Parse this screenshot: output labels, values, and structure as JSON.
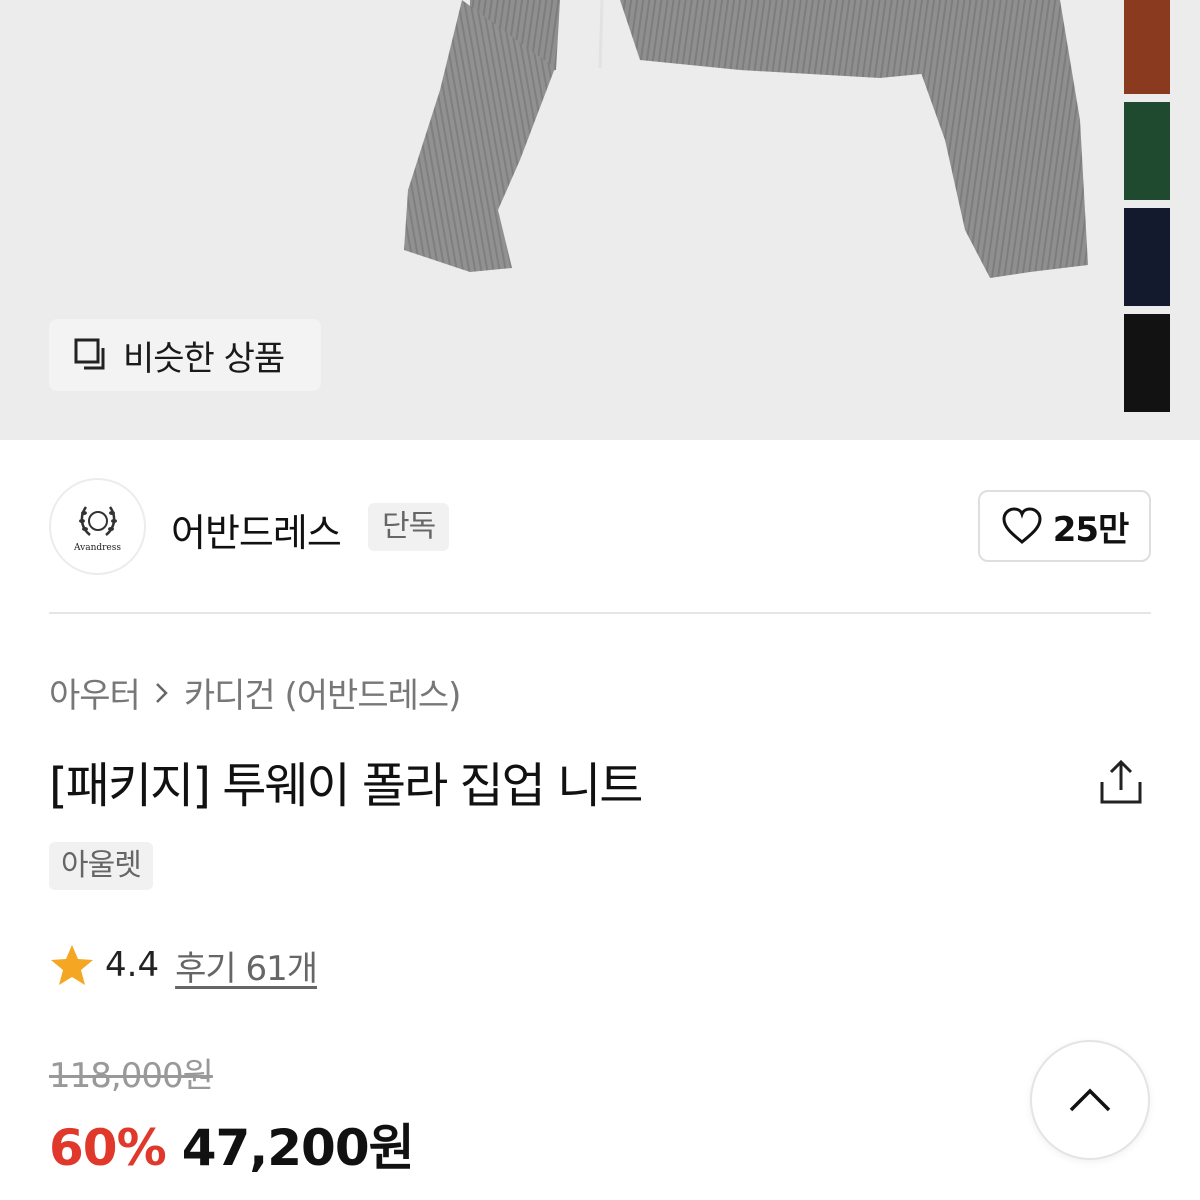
{
  "colors": {
    "accent_discount": "#e0392b",
    "star": "#f5a623",
    "hero_bg": "#ececec",
    "knit_gray": "#8d8d8d",
    "swatches": [
      "#8a3a1e",
      "#1f4a30",
      "#141a2e",
      "#121212"
    ]
  },
  "hero": {
    "similar_button": {
      "icon": "copy-icon",
      "label": "비슷한 상품"
    }
  },
  "brand": {
    "logo_text": "Avandress",
    "name": "어반드레스",
    "badge": "단독",
    "like": {
      "icon": "heart-icon",
      "count": "25만"
    }
  },
  "breadcrumb": {
    "level1": "아우터",
    "separator_icon": "chevron-right-icon",
    "level2": "카디건 (어반드레스)"
  },
  "product": {
    "title": "[패키지] 투웨이 폴라 집업 니트",
    "share_icon": "share-icon",
    "tag": "아울렛",
    "rating": {
      "icon": "star-icon",
      "score": "4.4",
      "reviews": "후기 61개"
    },
    "original_price": "118,000원",
    "discount": "60%",
    "price": "47,200원"
  },
  "scroll_top": {
    "icon": "chevron-up-icon"
  }
}
